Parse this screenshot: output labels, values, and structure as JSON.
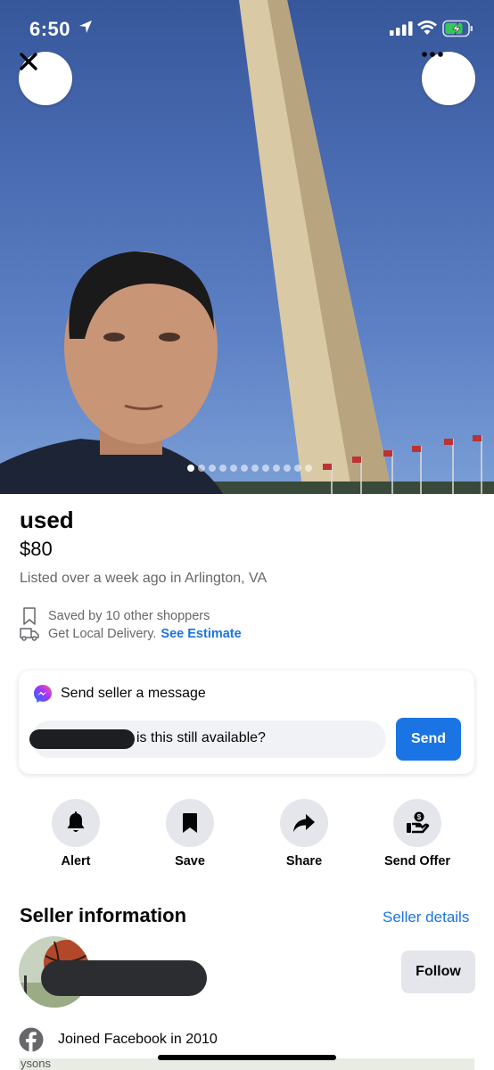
{
  "status_bar": {
    "time": "6:50"
  },
  "photo": {
    "total_photos": 12,
    "active_index": 0
  },
  "listing": {
    "title": "used",
    "price": "$80",
    "listed": "Listed over a week ago in Arlington, VA",
    "saved_text": "Saved by 10 other shoppers",
    "delivery_text": "Get Local Delivery.",
    "delivery_link": "See Estimate"
  },
  "message": {
    "heading": "Send seller a message",
    "input_value": "is this still available?",
    "send_label": "Send"
  },
  "actions": [
    {
      "label": "Alert",
      "icon": "bell-icon"
    },
    {
      "label": "Save",
      "icon": "bookmark-icon"
    },
    {
      "label": "Share",
      "icon": "share-arrow-icon"
    },
    {
      "label": "Send Offer",
      "icon": "offer-hand-icon"
    }
  ],
  "seller": {
    "heading": "Seller information",
    "details_link": "Seller details",
    "follow_label": "Follow",
    "joined": "Joined Facebook in 2010"
  },
  "map": {
    "label": "ysons"
  },
  "colors": {
    "accent": "#1b74e4",
    "button_gray": "#e4e6eb",
    "secondary_text": "#65676b"
  }
}
